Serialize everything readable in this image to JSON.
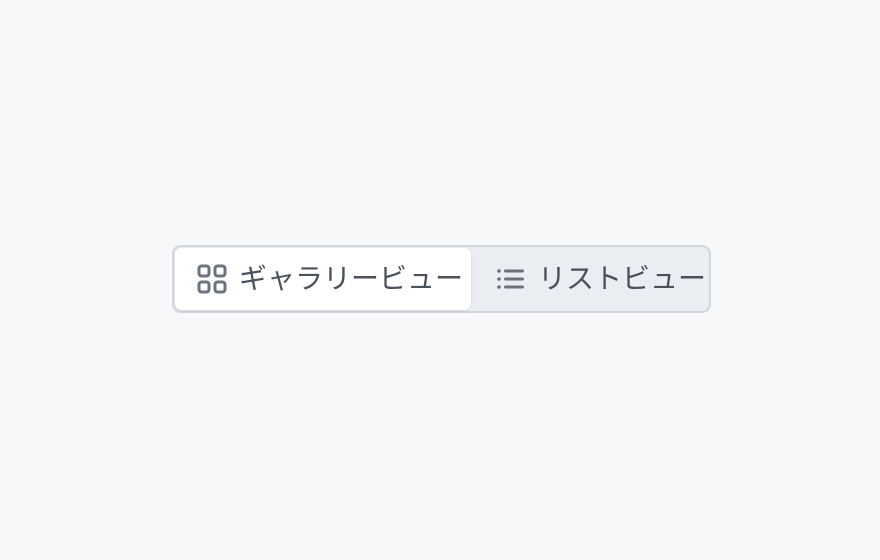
{
  "view_switcher": {
    "selected": "gallery",
    "options": [
      {
        "id": "gallery",
        "label": "ギャラリービュー",
        "icon": "grid-icon",
        "active": true
      },
      {
        "id": "list",
        "label": "リストビュー",
        "icon": "list-icon",
        "active": false
      }
    ]
  },
  "colors": {
    "background": "#f7f8fa",
    "track": "#eaedf1",
    "border": "#d3d7dd",
    "active_bg": "#ffffff",
    "icon": "#6b727c",
    "text": "#4a515b"
  }
}
